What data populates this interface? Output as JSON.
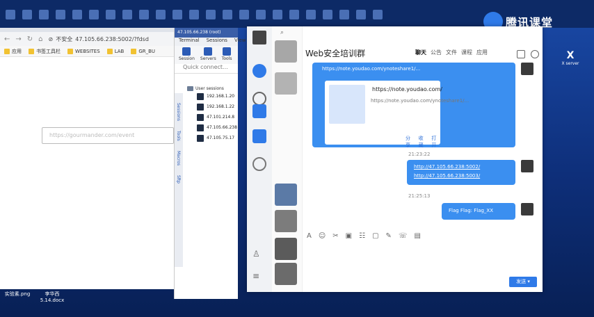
{
  "brand": {
    "name": "腾讯课堂"
  },
  "browser": {
    "address": {
      "warning": "不安全",
      "url": "47.105.66.238:5002/?fdsd"
    },
    "bookmarks": [
      {
        "label": "应用"
      },
      {
        "label": "书签工具栏"
      },
      {
        "label": "WEBSITES"
      },
      {
        "label": "LAB"
      },
      {
        "label": "GR_BU"
      }
    ],
    "url_input": {
      "placeholder": "https://gourmander.com/event"
    }
  },
  "ssh": {
    "title": "47.105.66.238 (root)",
    "menu": [
      "Terminal",
      "Sessions",
      "View"
    ],
    "tools": [
      {
        "label": "Session"
      },
      {
        "label": "Servers"
      },
      {
        "label": "Tools"
      }
    ],
    "quick_connect": "Quick connect...",
    "side_tabs": [
      "Sessions",
      "Tools",
      "Macros",
      "Sftp"
    ],
    "group": "User sessions",
    "sessions": [
      "192.168.1.20",
      "192.168.1.22",
      "47.101.214.8",
      "47.105.66.238",
      "47.105.75.17"
    ]
  },
  "chat": {
    "title": "Web安全培训群",
    "tabs": [
      "聊天",
      "公告",
      "文件",
      "课程",
      "应用"
    ],
    "link_text": "https://note.youdao.com/ynoteshare1/...",
    "card": {
      "url": "https://note.youdao.com/",
      "desc": "https://note.youdao.com/ynoteshare1/...",
      "actions": [
        "分享",
        "收藏",
        "打开"
      ]
    },
    "time1": "21:23:22",
    "links2": [
      "http://47.105.66.238:5002/",
      "http://47.105.66.238:5003/"
    ],
    "time2": "21:25:13",
    "msg3": "Flag     Flag: Flag_XX",
    "toolbar_icons": [
      "A",
      "☺",
      "✂",
      "▣",
      "☷",
      "▢",
      "✎",
      "☏",
      "▤"
    ],
    "send_label": "发送 ▾"
  },
  "xserver": {
    "label": "X server"
  },
  "desktop_files": [
    {
      "label": "实验素.png"
    },
    {
      "label": "李华西 5.14.docx"
    }
  ],
  "colors": {
    "accent": "#2f7ae8",
    "bubble": "#3b8ff0",
    "desktop": "#0e2f7a"
  }
}
